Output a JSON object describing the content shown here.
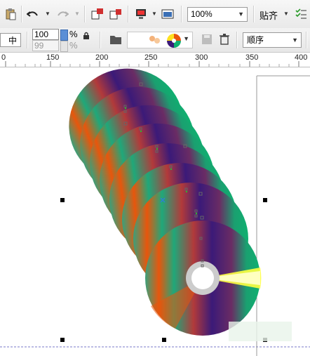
{
  "toolbar": {
    "zoom_value": "100%",
    "snap_label": "贴齐",
    "icons": [
      "clipboard-icon",
      "undo-icon",
      "redo-icon",
      "import-icon",
      "export-icon",
      "publish-icon",
      "app-launcher-icon",
      "options-icon"
    ]
  },
  "property_bar": {
    "width_percent": "100",
    "height_percent": "99",
    "percent_sign": "%",
    "order_value": "顺序"
  },
  "ruler": {
    "labels": [
      "0",
      "150",
      "200",
      "250",
      "300",
      "350",
      "400"
    ]
  },
  "colors": {
    "disc_green": "#0fb070",
    "disc_purple": "#3b1a78",
    "disc_orange": "#e8560c",
    "disc_yellow": "#ffff20",
    "accent_blue": "#2f7fd4"
  }
}
